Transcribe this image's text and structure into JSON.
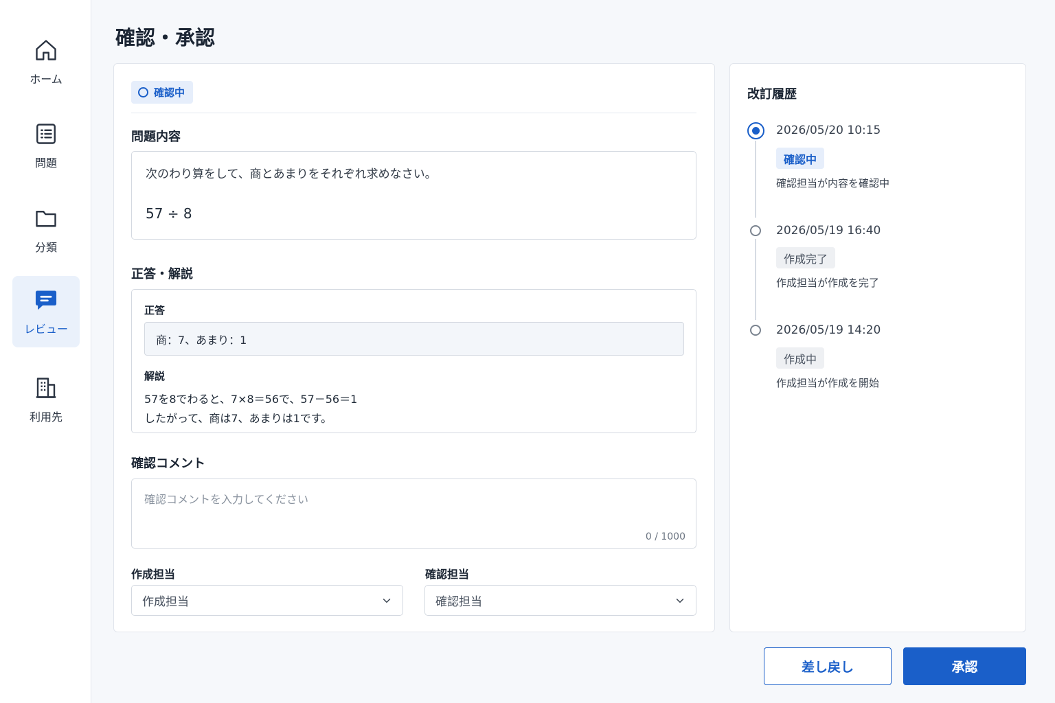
{
  "sidebar": {
    "items": [
      {
        "label": "ホーム",
        "icon": "home-icon"
      },
      {
        "label": "問題",
        "icon": "list-icon"
      },
      {
        "label": "分類",
        "icon": "folder-icon"
      },
      {
        "label": "レビュー",
        "icon": "message-icon",
        "active": true
      },
      {
        "label": "利用先",
        "icon": "building-icon"
      }
    ]
  },
  "page": {
    "title": "確認・承認"
  },
  "main": {
    "status_badge": "確認中",
    "question": {
      "heading": "問題内容",
      "text": "次のわり算をして、商とあまりをそれぞれ求めなさい。",
      "expression": "57 ÷ 8"
    },
    "answer": {
      "heading": "正答・解説",
      "answer_label": "正答",
      "answer_value": "商：7、あまり：1",
      "explanation_label": "解説",
      "explanation_lines": [
        "57を8でわると、7×8＝56で、57－56＝1",
        "したがって、商は7、あまりは1です。"
      ]
    },
    "comment": {
      "heading": "確認コメント",
      "placeholder": "確認コメントを入力してください",
      "count": "0 / 1000"
    },
    "selects": {
      "creator_label": "作成担当",
      "creator_value": "作成担当",
      "reviewer_label": "確認担当",
      "reviewer_value": "確認担当"
    }
  },
  "history": {
    "title": "改訂履歴",
    "entries": [
      {
        "date": "2026/05/20 10:15",
        "status": "確認中",
        "description": "確認担当が内容を確認中",
        "current": true
      },
      {
        "date": "2026/05/19 16:40",
        "status": "作成完了",
        "description": "作成担当が作成を完了",
        "current": false
      },
      {
        "date": "2026/05/19 14:20",
        "status": "作成中",
        "description": "作成担当が作成を開始",
        "current": false
      }
    ]
  },
  "actions": {
    "return_label": "差し戻し",
    "approve_label": "承認"
  },
  "colors": {
    "accent": "#1a5fc9",
    "accent_bg": "#e6eefb",
    "background": "#f6f8fb"
  }
}
